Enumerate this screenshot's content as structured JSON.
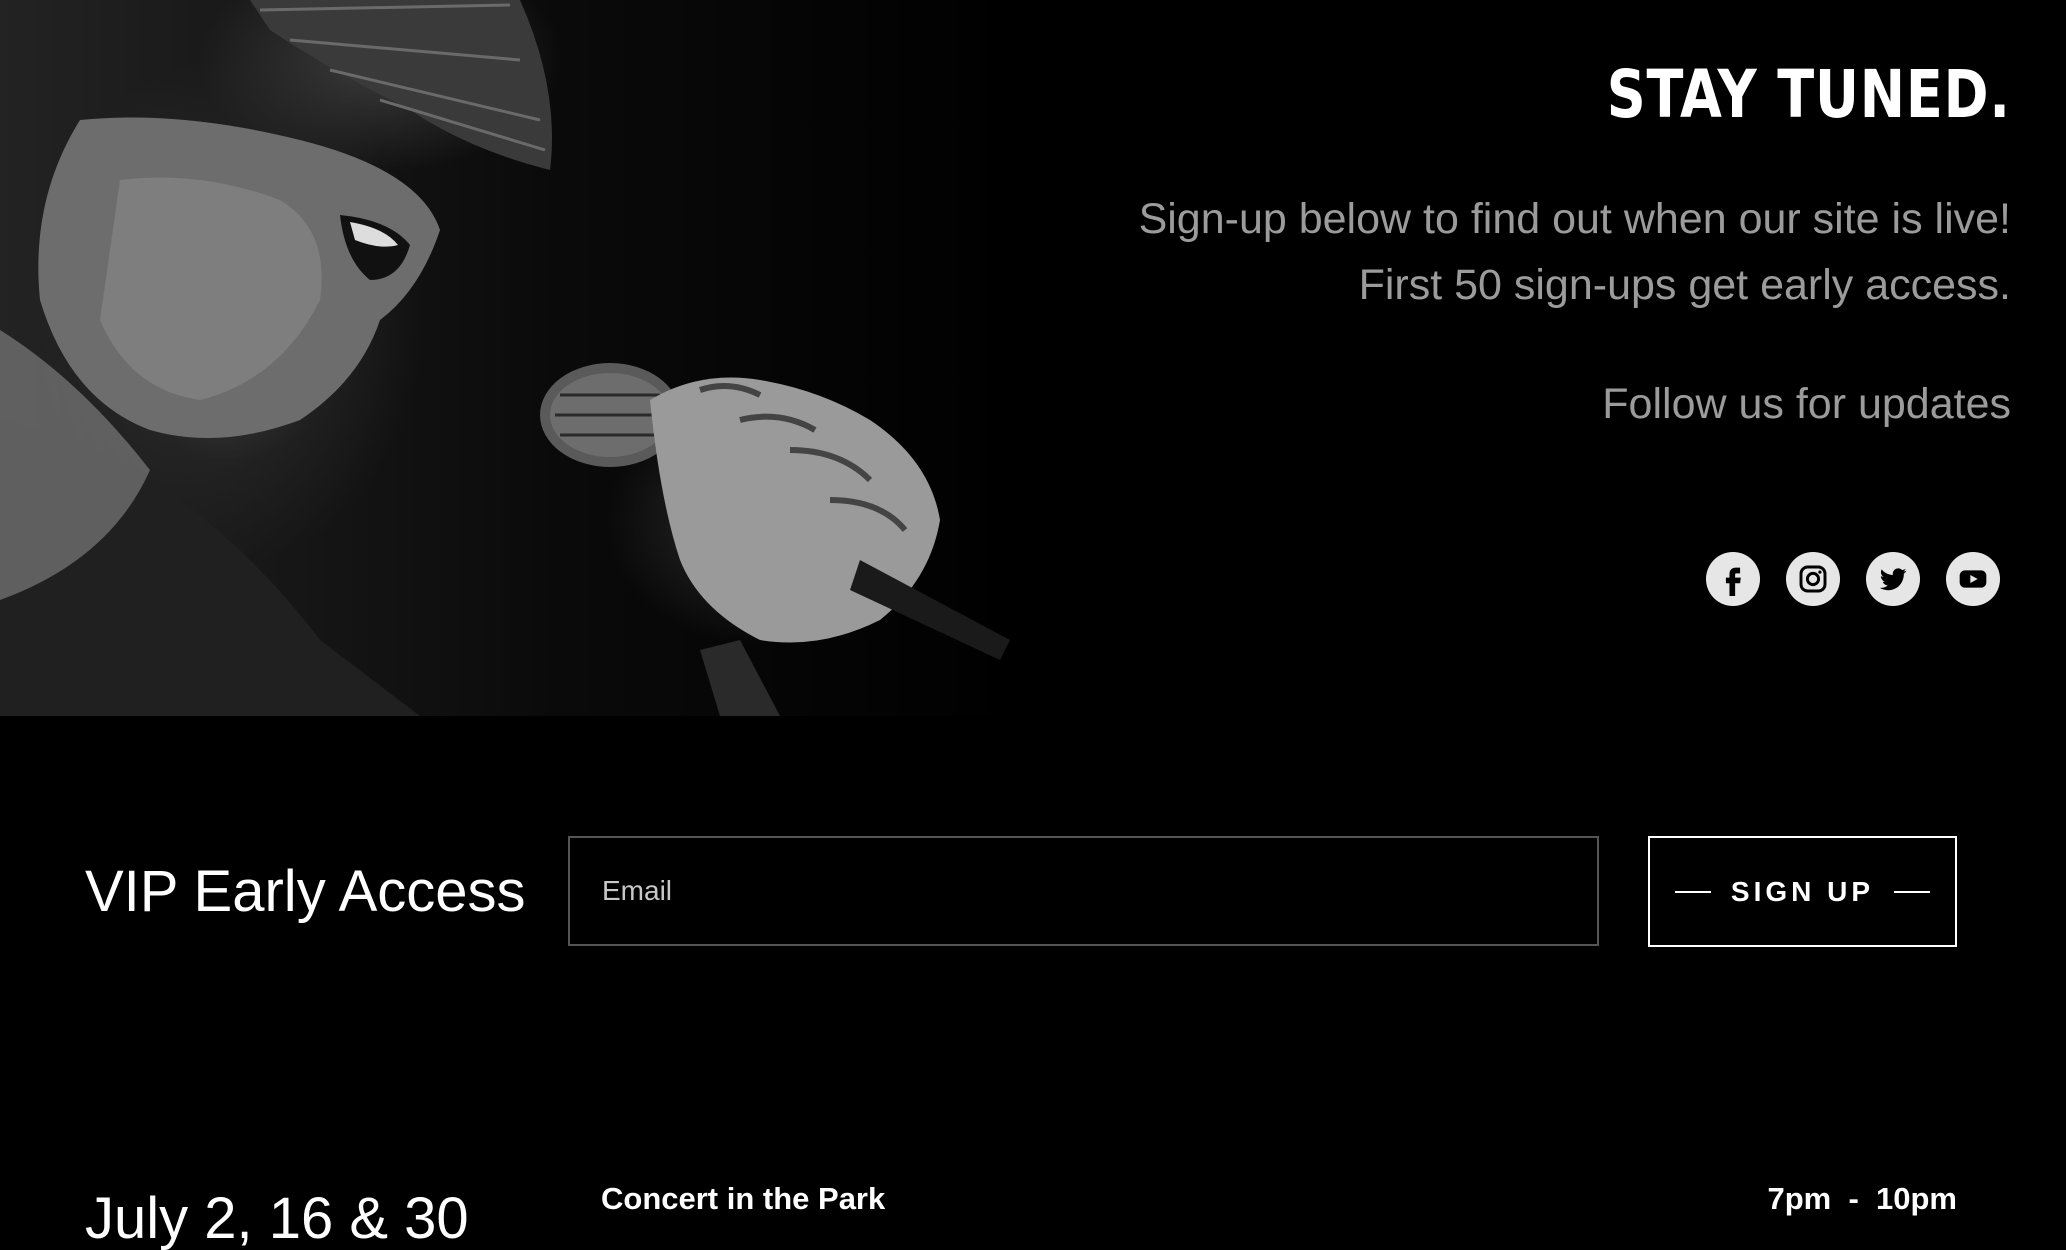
{
  "hero": {
    "title": "STAY TUNED.",
    "signup_line_1": "Sign-up below to find out when our site is live!",
    "signup_line_2": "First 50 sign-ups get early access.",
    "follow_text": "Follow us for updates"
  },
  "socials": [
    {
      "name": "facebook",
      "icon": "facebook-icon"
    },
    {
      "name": "instagram",
      "icon": "instagram-icon"
    },
    {
      "name": "twitter",
      "icon": "twitter-icon"
    },
    {
      "name": "youtube",
      "icon": "youtube-icon"
    }
  ],
  "vip": {
    "title": "VIP Early Access",
    "email_placeholder": "Email",
    "email_value": "",
    "button_label": "SIGN UP"
  },
  "event": {
    "date": "July 2, 16 & 30",
    "name": "Concert in the Park",
    "time": "7pm  -  10pm"
  },
  "colors": {
    "background": "#000000",
    "primary_text": "#ffffff",
    "secondary_text": "#9b9b9b",
    "social_icon_bg": "#e6e6e6",
    "input_border": "#555555"
  }
}
